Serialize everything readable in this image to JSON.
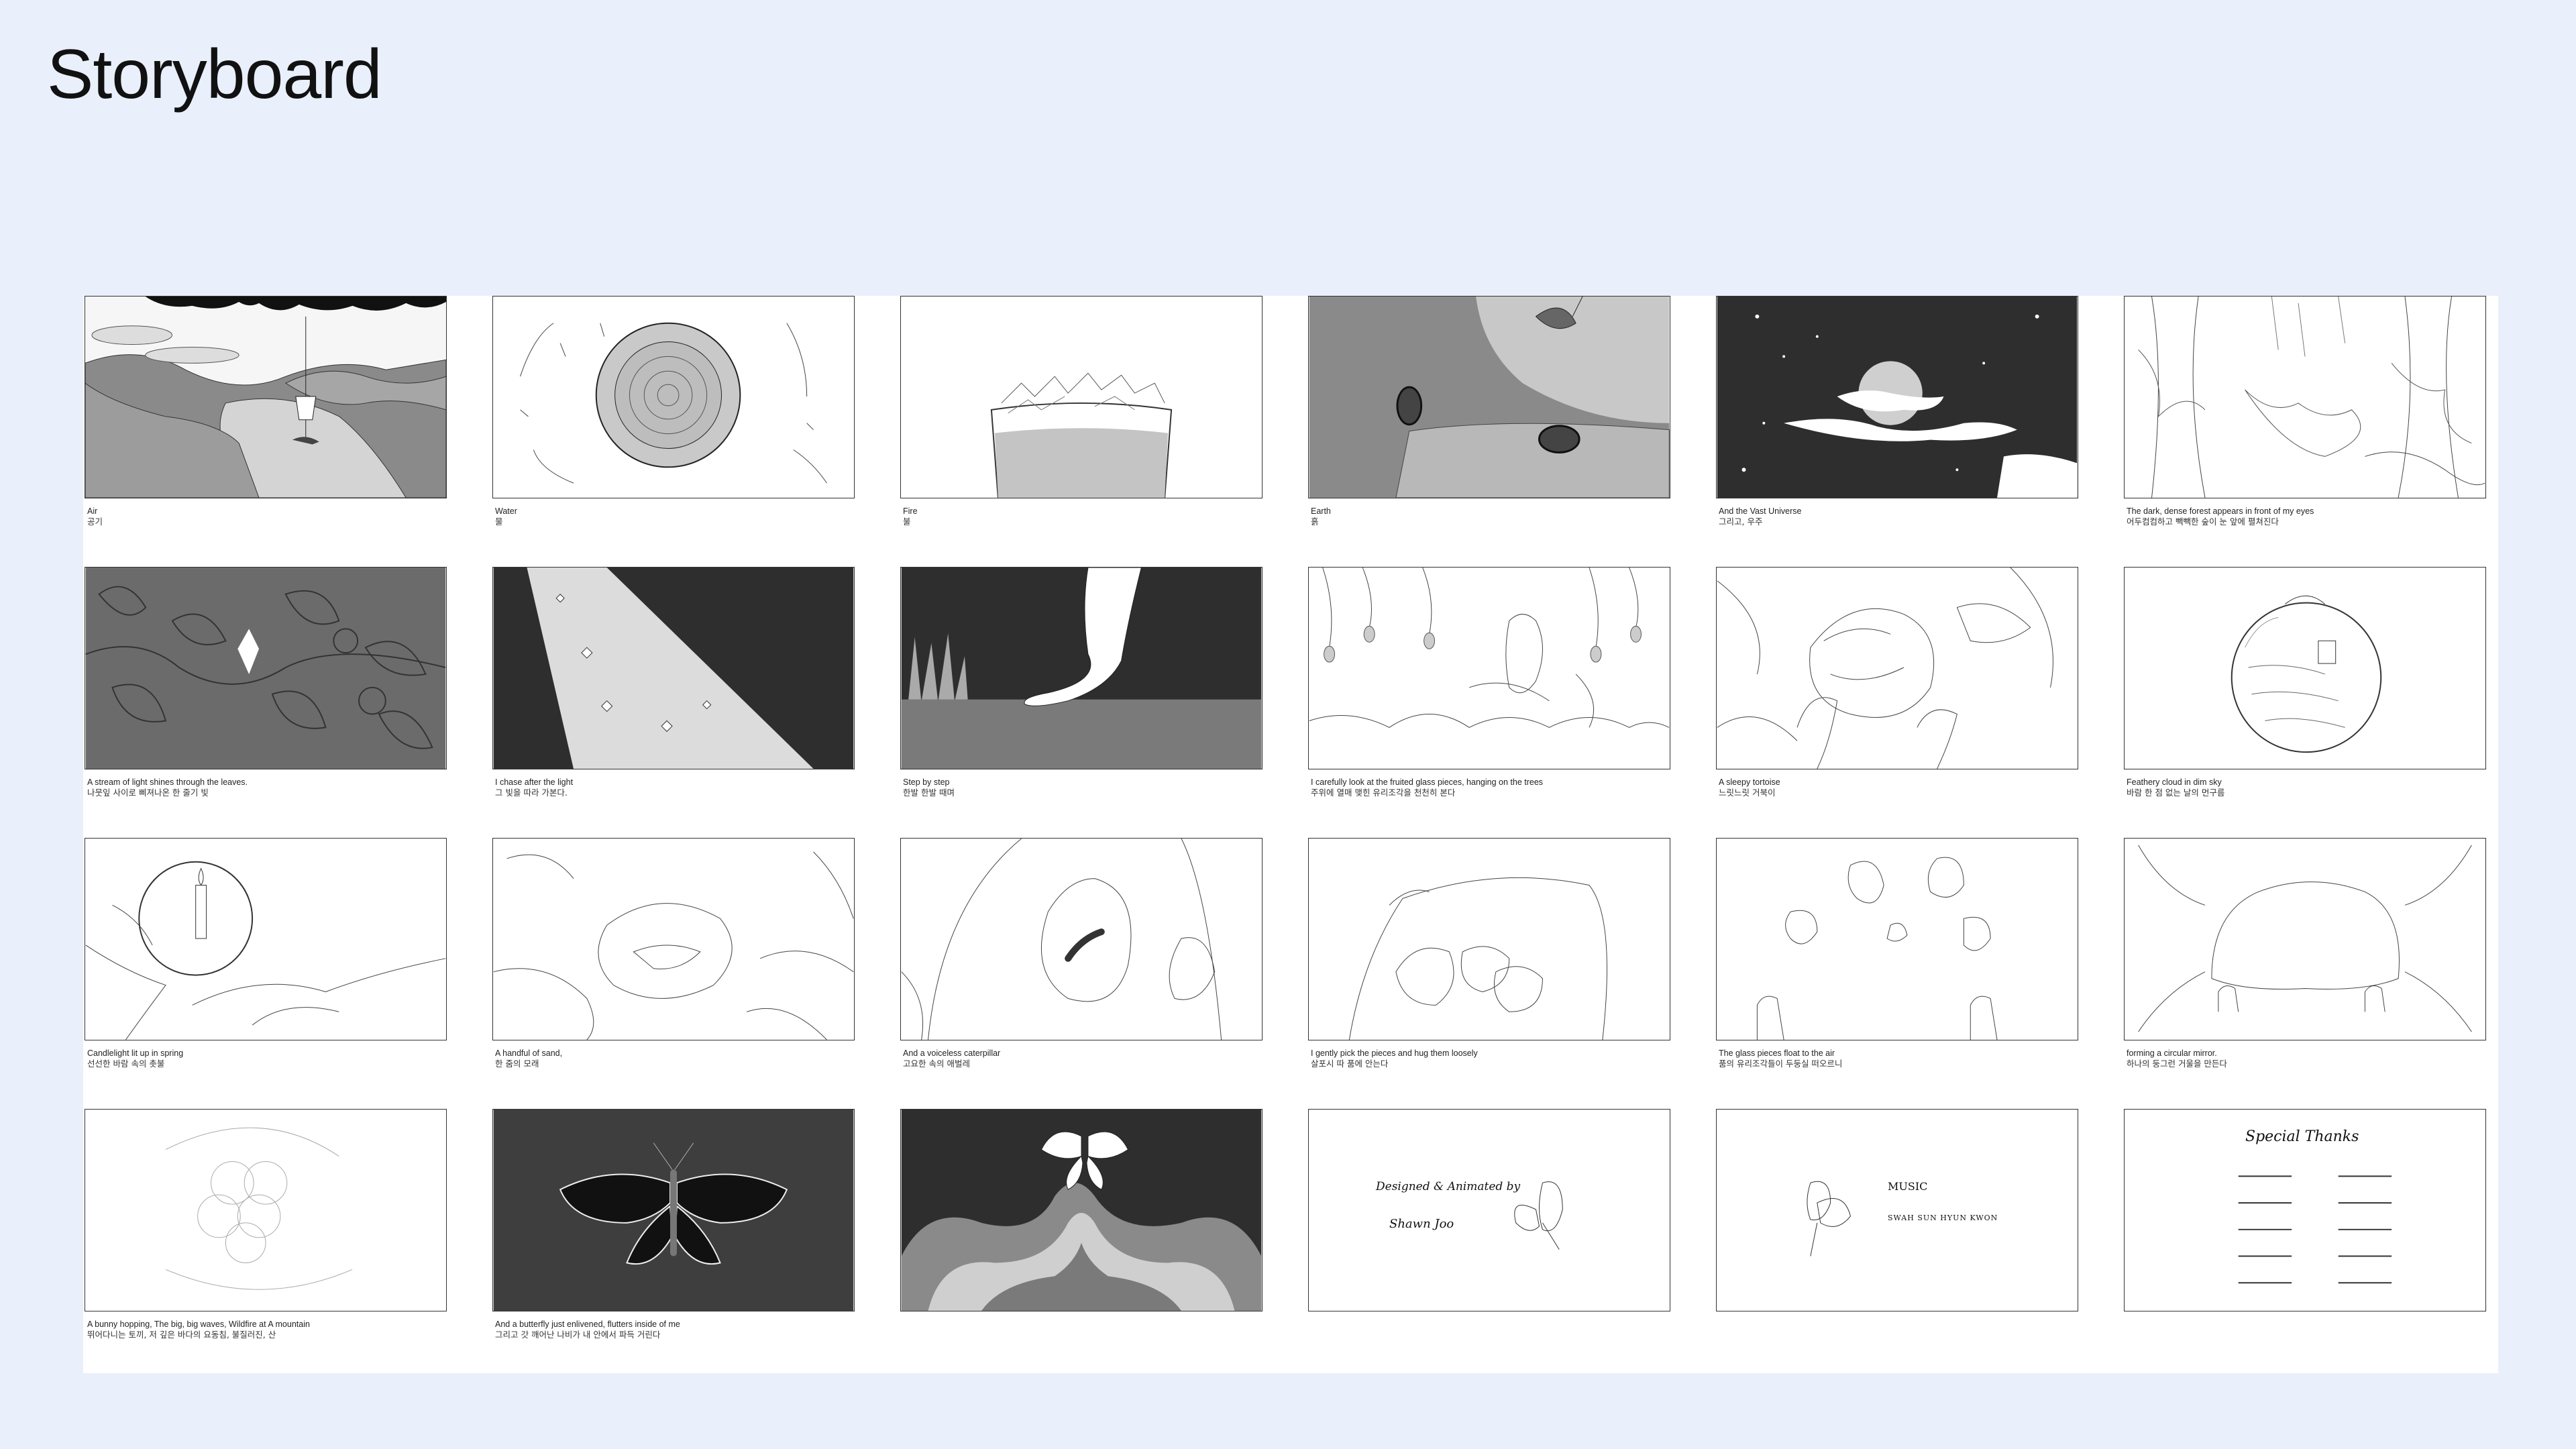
{
  "page": {
    "title": "Storyboard"
  },
  "panels": [
    {
      "id": "air",
      "en": "Air",
      "ko": "공기"
    },
    {
      "id": "water",
      "en": "Water",
      "ko": "물"
    },
    {
      "id": "fire",
      "en": "Fire",
      "ko": "불"
    },
    {
      "id": "earth",
      "en": "Earth",
      "ko": "흙"
    },
    {
      "id": "universe",
      "en": "And the Vast Universe",
      "ko": "그리고, 우주"
    },
    {
      "id": "forest",
      "en": "The dark, dense forest appears in front of my eyes",
      "ko": "어두컴컴하고 빽빽한 숲이 눈 앞에 펼쳐진다"
    },
    {
      "id": "light-leaves",
      "en": "A stream of light shines through the leaves.",
      "ko": "나뭇잎 사이로 삐져나온 한 줄기 빛"
    },
    {
      "id": "chase-light",
      "en": "I chase after the light",
      "ko": "그 빛을 따라 가본다."
    },
    {
      "id": "step",
      "en": "Step by step",
      "ko": "한발 한발 때며"
    },
    {
      "id": "glass-pieces",
      "en": "I carefully look at the fruited glass pieces, hanging on the trees",
      "ko": "주위에 열매 맺힌 유리조각을 천천히 본다"
    },
    {
      "id": "tortoise",
      "en": "A sleepy tortoise",
      "ko": "느릿느릿 거북이"
    },
    {
      "id": "feathery-cloud",
      "en": "Feathery cloud in dim sky",
      "ko": "바람 한 점 없는 날의 먼구름"
    },
    {
      "id": "candlelight",
      "en": "Candlelight lit up in spring",
      "ko": "선선한 바람 속의 촛불"
    },
    {
      "id": "sand",
      "en": "A handful of sand,",
      "ko": "한 줌의 모래"
    },
    {
      "id": "caterpillar",
      "en": "And a voiceless caterpillar",
      "ko": "고요한 속의 애벌레"
    },
    {
      "id": "hug",
      "en": "I gently pick the pieces and hug them loosely",
      "ko": "살포시 따 품에 안는다"
    },
    {
      "id": "float",
      "en": "The glass pieces float to the air",
      "ko": "품의 유리조각들이 두둥실 떠오르니"
    },
    {
      "id": "mirror",
      "en": "forming a circular mirror.",
      "ko": "하나의 둥그런 거울을 만든다"
    },
    {
      "id": "bunny",
      "en": "A bunny hopping, The big, big waves, Wildfire at A mountain",
      "ko": "뛰어다니는 토끼, 저 깊은 바다의 요동침, 불질러진, 산"
    },
    {
      "id": "butterfly",
      "en": "And a butterfly just enlivened, flutters inside of me",
      "ko": "그리고 갓 깨어난 나비가 내 안에서 파득 거린다"
    },
    {
      "id": "waves-butterfly",
      "en": "",
      "ko": ""
    },
    {
      "id": "credits",
      "en": "",
      "ko": "",
      "text1": "Designed & Animated by",
      "text2": "Shawn Joo"
    },
    {
      "id": "music",
      "en": "",
      "ko": "",
      "text1": "MUSIC",
      "text2": "SWAH SUN HYUN KWON"
    },
    {
      "id": "thanks",
      "en": "",
      "ko": "",
      "text1": "Special Thanks"
    }
  ]
}
